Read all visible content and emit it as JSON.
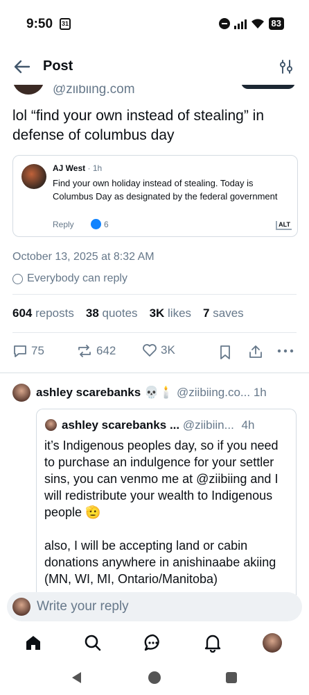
{
  "status_bar": {
    "time": "9:50",
    "calendar_date": "31",
    "battery": "83"
  },
  "header": {
    "title": "Post"
  },
  "post": {
    "author_handle_partial": "@ziibiing.com",
    "text": "lol “find your own instead of stealing” in defense of columbus day",
    "quoted": {
      "author": "AJ West",
      "time": "1h",
      "text": "Find your own holiday instead of stealing. Today is Columbus Day as designated by the federal government",
      "reply_label": "Reply",
      "like_count": "6",
      "alt_badge": "ALT"
    },
    "date": "October 13, 2025 at 8:32 AM",
    "reply_setting": "Everybody can reply",
    "stats": {
      "reposts_count": "604",
      "reposts_label": "reposts",
      "quotes_count": "38",
      "quotes_label": "quotes",
      "likes_count": "3K",
      "likes_label": "likes",
      "saves_count": "7",
      "saves_label": "saves"
    },
    "actions": {
      "replies": "75",
      "reposts": "642",
      "likes": "3K"
    }
  },
  "reply": {
    "author_name": "ashley scarebanks 💀🕯️",
    "author_handle": "@ziibiing.co...",
    "time": "1h",
    "quoted": {
      "author_name": "ashley scarebanks ...",
      "author_handle": "@ziibiin...",
      "time": "4h",
      "paragraph1": "it’s Indigenous peoples day, so if you need to purchase an indulgence for your settler sins, you can venmo me at @ziibiing and I will redistribute your wealth to Indigenous people 🫡",
      "paragraph2": "also, I will be accepting land or cabin donations anywhere in anishinaabe akiing (MN, WI, MI, Ontario/Manitoba)"
    }
  },
  "compose": {
    "placeholder": "Write your reply"
  },
  "colors": {
    "accent": "#1083fe",
    "muted": "#66788a",
    "text": "#0b0f14",
    "border": "#d4dbe2"
  }
}
